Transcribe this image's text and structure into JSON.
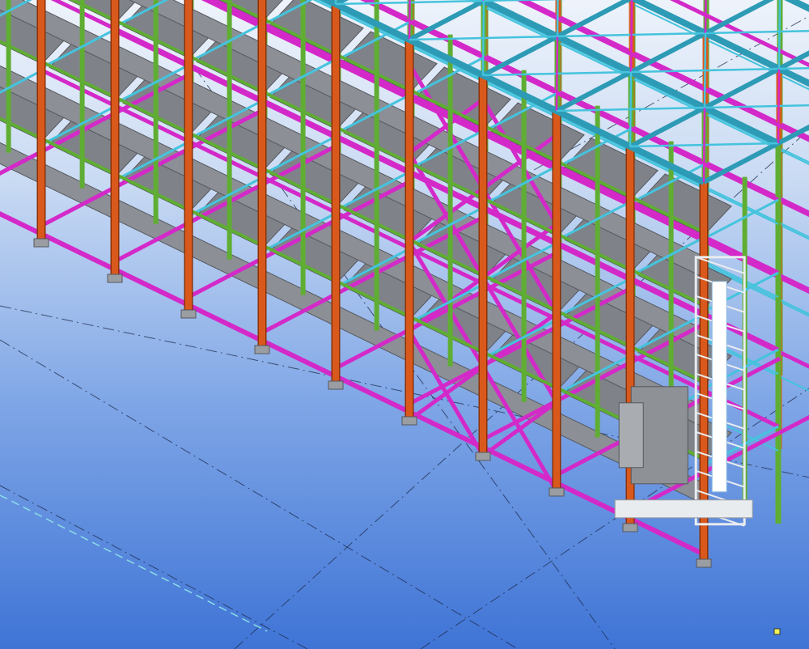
{
  "viewport": {
    "background_top": "#eef3fb",
    "background_bottom": "#3f74d6"
  },
  "model": {
    "colors": {
      "column": "#d9591c",
      "column_edge": "#8a3208",
      "green_member": "#5fae33",
      "cyan_truss": "#2d9bb5",
      "cyan_light": "#45c3dd",
      "magenta_bracing": "#d429c9",
      "grey_panel": "#7f8288",
      "grey_panel_edge": "#55585d",
      "equipment_white": "#e9ecef",
      "equipment_grey": "#8e9196",
      "grid_line": "#1d2a4a",
      "grid_cyan": "#8fe3e8",
      "base_plate": "#9a9da2"
    },
    "icons": [
      "coordinate-marker-icon"
    ]
  }
}
